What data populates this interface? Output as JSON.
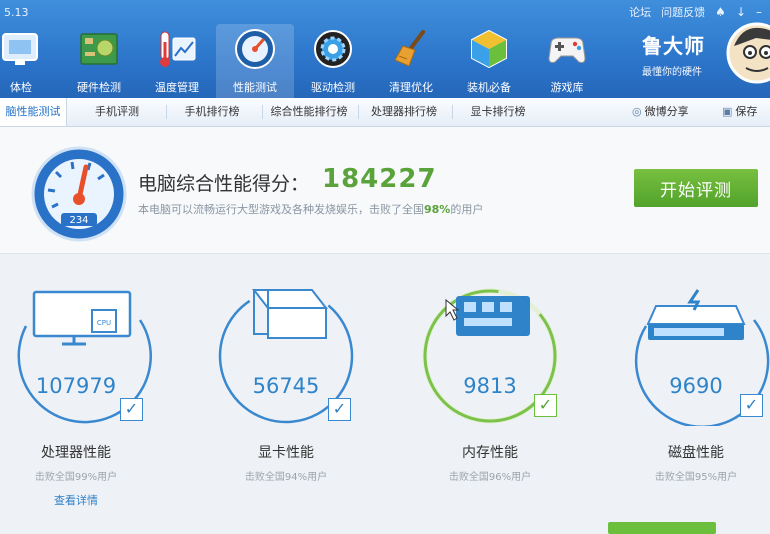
{
  "app": {
    "version": "5.13",
    "links": {
      "forum": "论坛",
      "feedback": "问题反馈"
    },
    "nav": [
      {
        "label": "体检",
        "icon": "monitor-icon"
      },
      {
        "label": "硬件检测",
        "icon": "circuit-board-icon"
      },
      {
        "label": "温度管理",
        "icon": "thermometer-icon"
      },
      {
        "label": "性能测试",
        "icon": "speedometer-icon"
      },
      {
        "label": "驱动检测",
        "icon": "gear-icon"
      },
      {
        "label": "清理优化",
        "icon": "broom-icon"
      },
      {
        "label": "装机必备",
        "icon": "cube-icon"
      },
      {
        "label": "游戏库",
        "icon": "gamepad-icon"
      }
    ],
    "brand": {
      "name": "鲁大师",
      "slogan": "最懂你的硬件"
    }
  },
  "tabs": [
    {
      "label": "脑性能测试"
    },
    {
      "label": "手机评测"
    },
    {
      "label": "手机排行榜"
    },
    {
      "label": "综合性能排行榜"
    },
    {
      "label": "处理器排行榜"
    },
    {
      "label": "显卡排行榜"
    }
  ],
  "tools": {
    "share": "微博分享",
    "save": "保存"
  },
  "score": {
    "title": "电脑综合性能得分：",
    "value": "184227",
    "subtitle_before": "本电脑可以流畅运行大型游戏及各种发烧娱乐，击败了全国",
    "percent": "98%",
    "subtitle_after": "的用户",
    "gauge_readout": "234",
    "start_button": "开始评测"
  },
  "cards": [
    {
      "value": "107979",
      "label": "处理器性能",
      "sub": "击败全国99%用户",
      "link": "查看详情",
      "icon": "cpu-monitor-icon"
    },
    {
      "value": "56745",
      "label": "显卡性能",
      "sub": "击败全国94%用户",
      "icon": "graphics-card-icon"
    },
    {
      "value": "9813",
      "label": "内存性能",
      "sub": "击败全国96%用户",
      "icon": "memory-chip-icon"
    },
    {
      "value": "9690",
      "label": "磁盘性能",
      "sub": "击败全国95%用户",
      "icon": "hard-disk-icon"
    }
  ],
  "colors": {
    "header_blue": "#2a72c8",
    "accent_blue": "#2f83c8",
    "score_green": "#5aa33a",
    "button_green": "#52a22b"
  }
}
